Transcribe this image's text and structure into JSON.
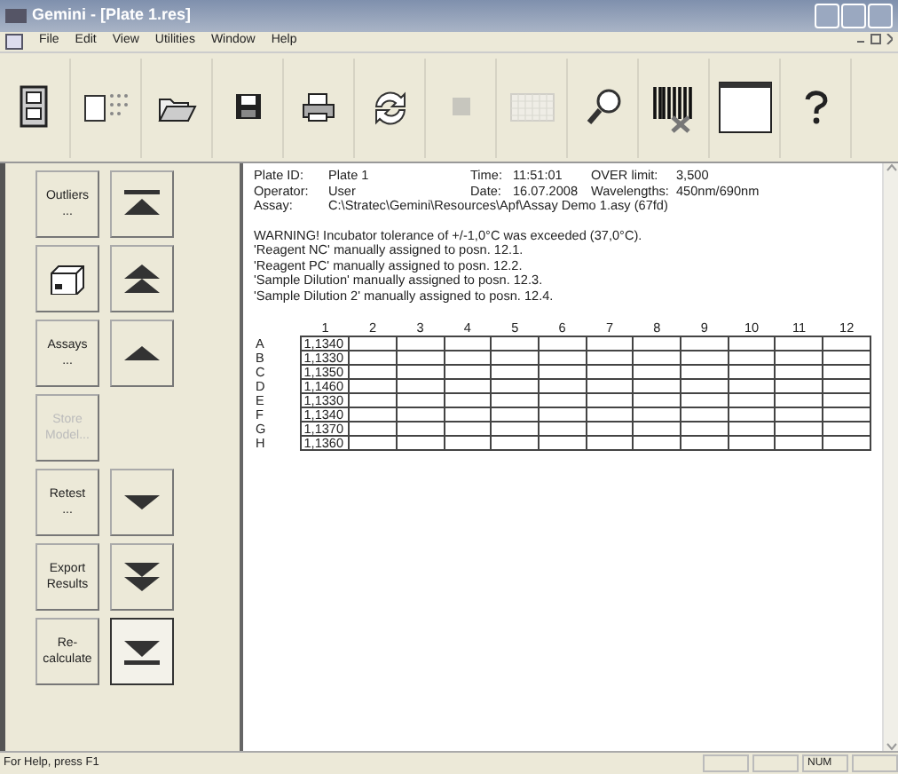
{
  "window": {
    "title": "Gemini - [Plate 1.res]"
  },
  "menu": [
    "File",
    "Edit",
    "View",
    "Utilities",
    "Window",
    "Help"
  ],
  "toolbar": [
    {
      "kind": "cabinet",
      "disabled": false
    },
    {
      "kind": "plate-doc",
      "disabled": false
    },
    {
      "kind": "open",
      "disabled": false
    },
    {
      "kind": "save",
      "disabled": false
    },
    {
      "kind": "print",
      "disabled": false
    },
    {
      "kind": "refresh",
      "disabled": false
    },
    {
      "kind": "stop",
      "disabled": true
    },
    {
      "kind": "grid",
      "disabled": true
    },
    {
      "kind": "magnifier",
      "disabled": false
    },
    {
      "kind": "barcode",
      "disabled": false
    },
    {
      "kind": "window",
      "disabled": false
    },
    {
      "kind": "help",
      "disabled": false
    }
  ],
  "side_buttons": [
    {
      "left": {
        "kind": "text",
        "label": "Outliers\n...",
        "disabled": false
      },
      "right": {
        "kind": "first",
        "pressed": false
      }
    },
    {
      "left": {
        "kind": "box",
        "disabled": false
      },
      "right": {
        "kind": "page-up",
        "pressed": false
      }
    },
    {
      "left": {
        "kind": "text",
        "label": "Assays\n...",
        "disabled": false
      },
      "right": {
        "kind": "up",
        "pressed": false
      }
    },
    {
      "left": {
        "kind": "text",
        "label": "Store\nModel...",
        "disabled": true
      }
    },
    {
      "left": {
        "kind": "text",
        "label": "Retest\n...",
        "disabled": false
      },
      "right": {
        "kind": "down",
        "pressed": false
      }
    },
    {
      "left": {
        "kind": "text",
        "label": "Export\nResults",
        "disabled": false
      },
      "right": {
        "kind": "page-down",
        "pressed": false
      }
    },
    {
      "left": {
        "kind": "text",
        "label": "Re-\ncalculate",
        "disabled": false
      },
      "right": {
        "kind": "last",
        "pressed": true
      }
    }
  ],
  "header": [
    {
      "label": "Plate ID:",
      "value": "Plate 1"
    },
    {
      "label": "Time:",
      "value": "11:51:01"
    },
    {
      "label": "OVER limit:",
      "value": "3,500"
    },
    {
      "label": "Operator:",
      "value": "User"
    },
    {
      "label": "Date:",
      "value": "16.07.2008"
    },
    {
      "label": "Wavelengths:",
      "value": "450nm/690nm"
    },
    {
      "label": "Assay:",
      "value": "C:\\Stratec\\Gemini\\Resources\\Apf\\Assay Demo 1.asy (67fd)"
    }
  ],
  "messages": [
    "WARNING! Incubator tolerance of +/-1,0°C was exceeded (37,0°C).",
    "'Reagent NC' manually assigned to posn. 12.1.",
    "'Reagent PC' manually assigned to posn. 12.2.",
    "'Sample Dilution' manually assigned to posn. 12.3.",
    "'Sample Dilution 2' manually assigned to posn. 12.4."
  ],
  "plate": {
    "columns": [
      "1",
      "2",
      "3",
      "4",
      "5",
      "6",
      "7",
      "8",
      "9",
      "10",
      "11",
      "12"
    ],
    "rows": [
      {
        "label": "A",
        "value": "1,1340"
      },
      {
        "label": "B",
        "value": "1,1330"
      },
      {
        "label": "C",
        "value": "1,1350"
      },
      {
        "label": "D",
        "value": "1,1460"
      },
      {
        "label": "E",
        "value": "1,1330"
      },
      {
        "label": "F",
        "value": "1,1340"
      },
      {
        "label": "G",
        "value": "1,1370"
      },
      {
        "label": "H",
        "value": "1,1360"
      }
    ]
  },
  "status_bar": {
    "text": "For Help, press F1",
    "indicators": [
      "NUM"
    ]
  }
}
